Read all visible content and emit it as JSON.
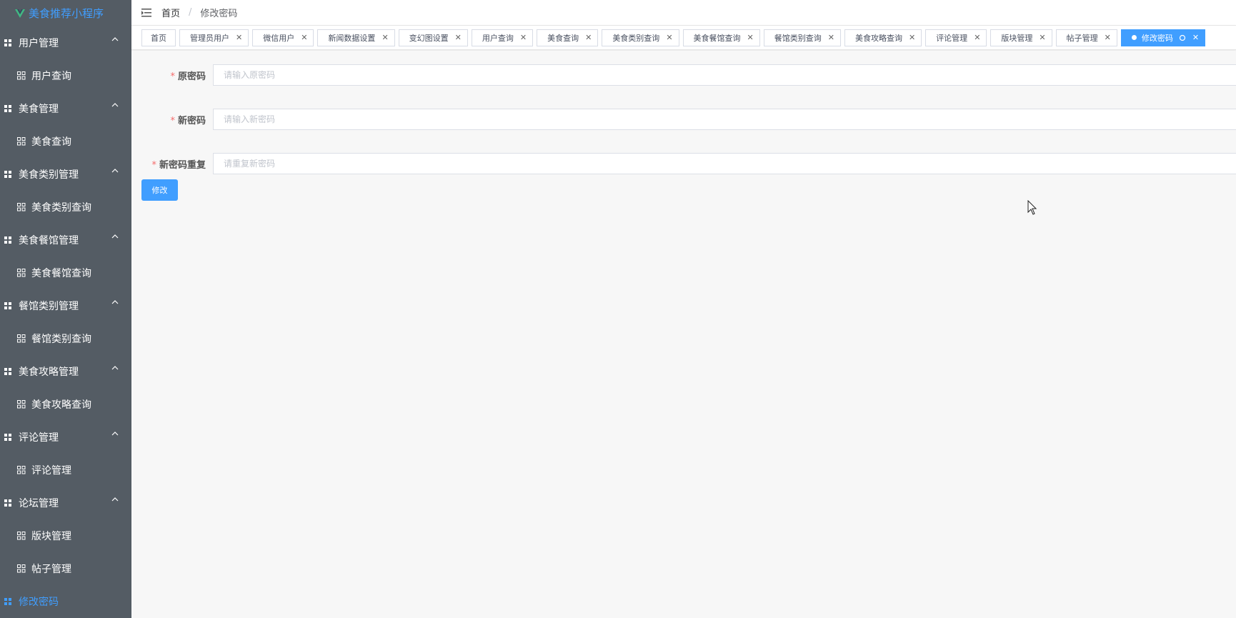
{
  "app": {
    "title": "美食推荐小程序",
    "accent": "#409eff",
    "sidebar_bg": "#545c64"
  },
  "sidebar": {
    "groups": [
      {
        "title": "用户管理",
        "items": [
          "用户查询"
        ]
      },
      {
        "title": "美食管理",
        "items": [
          "美食查询"
        ]
      },
      {
        "title": "美食类别管理",
        "items": [
          "美食类别查询"
        ]
      },
      {
        "title": "美食餐馆管理",
        "items": [
          "美食餐馆查询"
        ]
      },
      {
        "title": "餐馆类别管理",
        "items": [
          "餐馆类别查询"
        ]
      },
      {
        "title": "美食攻略管理",
        "items": [
          "美食攻略查询"
        ]
      },
      {
        "title": "评论管理",
        "items": [
          "评论管理"
        ]
      },
      {
        "title": "论坛管理",
        "items": [
          "版块管理",
          "帖子管理"
        ]
      }
    ],
    "active_item": "修改密码"
  },
  "header": {
    "breadcrumb_home": "首页",
    "breadcrumb_sep": "/",
    "breadcrumb_current": "修改密码"
  },
  "tags": {
    "home": "首页",
    "items": [
      "管理员用户",
      "微信用户",
      "新闻数据设置",
      "变幻图设置",
      "用户查询",
      "美食查询",
      "美食类别查询",
      "美食餐馆查询",
      "餐馆类别查询",
      "美食攻略查询",
      "评论管理",
      "版块管理",
      "帖子管理"
    ],
    "active": "修改密码",
    "close_glyph": "✕"
  },
  "form": {
    "old_password": {
      "label": "原密码",
      "placeholder": "请输入原密码",
      "value": ""
    },
    "new_password": {
      "label": "新密码",
      "placeholder": "请输入新密码",
      "value": ""
    },
    "repeat_password": {
      "label": "新密码重复",
      "placeholder": "请重复新密码",
      "value": ""
    },
    "submit_label": "修改",
    "required_mark": "*"
  }
}
